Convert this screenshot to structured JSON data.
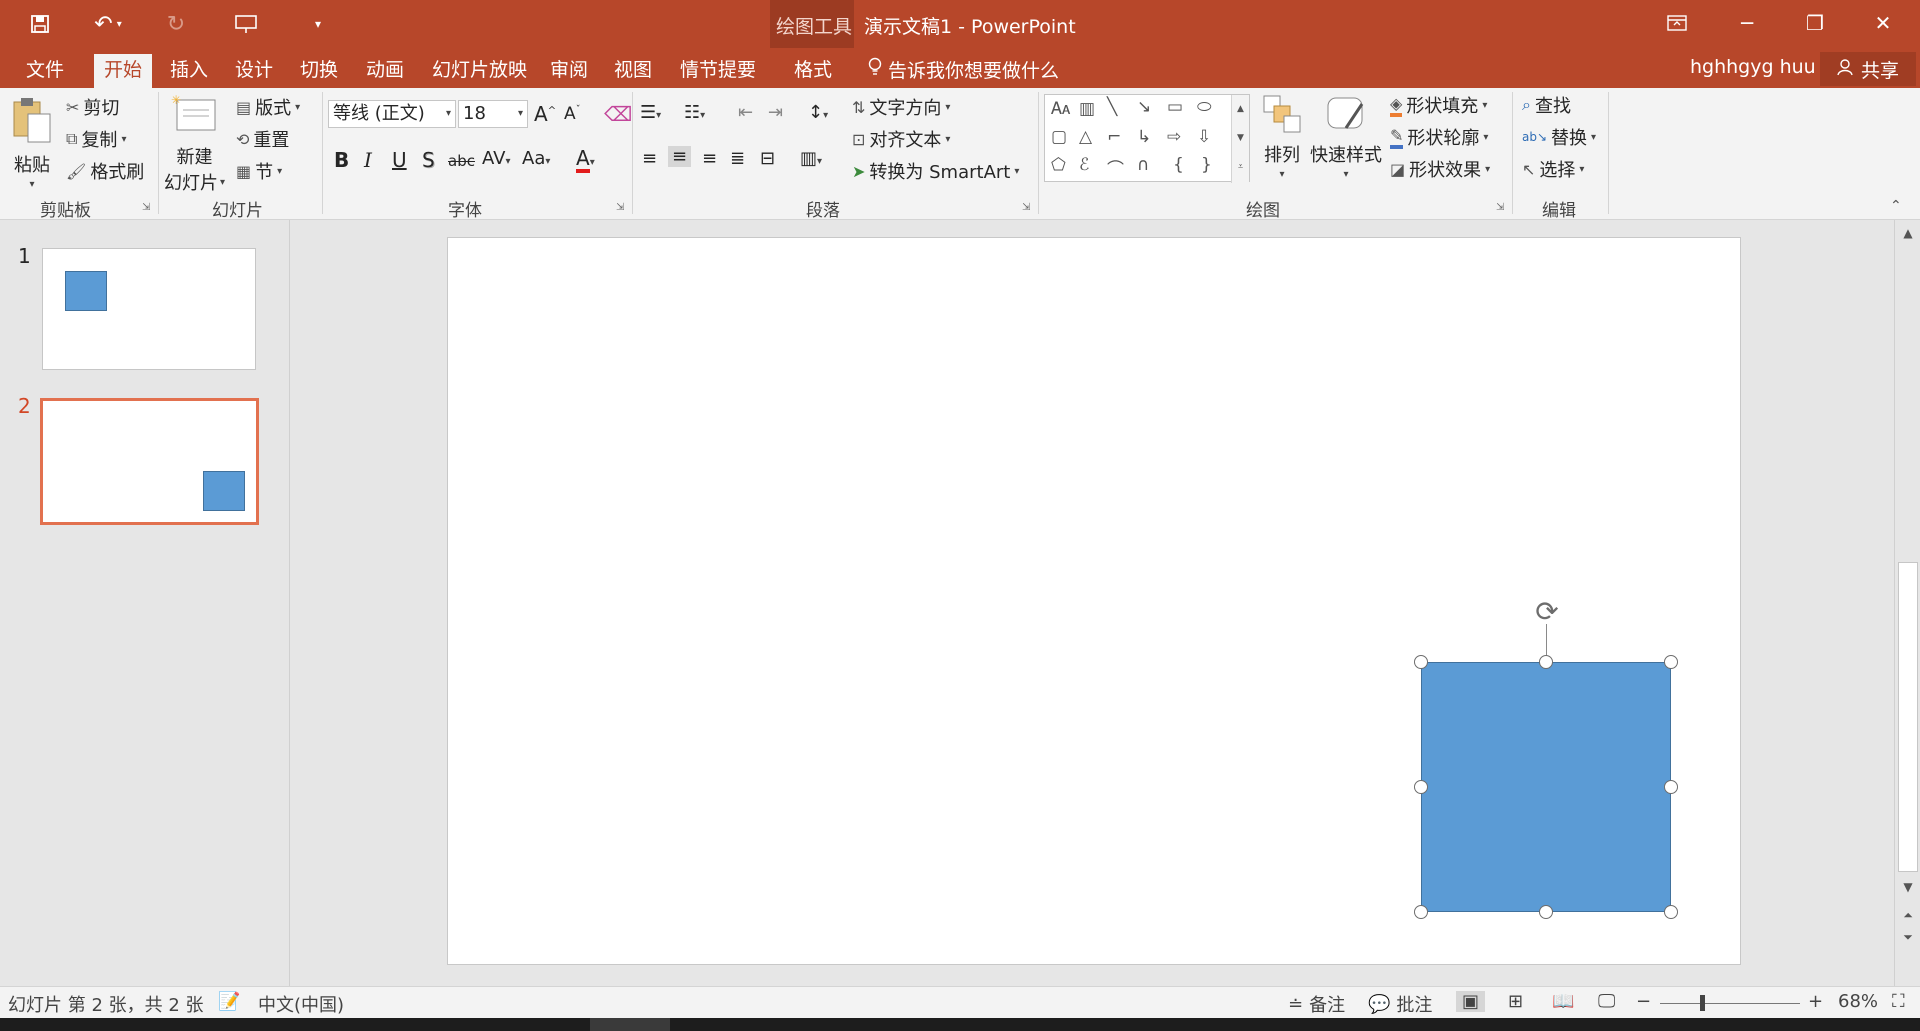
{
  "window": {
    "context_tab_label": "绘图工具",
    "title": "演示文稿1 - PowerPoint"
  },
  "quick_access": {
    "save_icon": "save-icon",
    "undo_icon": "undo-icon",
    "redo_icon": "redo-icon",
    "present_icon": "start-from-beginning-icon",
    "customize_icon": "customize-qat-icon"
  },
  "tabs": [
    {
      "label": "文件"
    },
    {
      "label": "开始"
    },
    {
      "label": "插入"
    },
    {
      "label": "设计"
    },
    {
      "label": "切换"
    },
    {
      "label": "动画"
    },
    {
      "label": "幻灯片放映"
    },
    {
      "label": "审阅"
    },
    {
      "label": "视图"
    },
    {
      "label": "情节提要"
    },
    {
      "label": "格式"
    }
  ],
  "tell_me": "告诉我你想要做什么",
  "user": {
    "name": "hghhgyg huu",
    "share_label": "共享"
  },
  "ribbon": {
    "clipboard": {
      "label": "剪贴板",
      "paste": "粘贴",
      "cut": "剪切",
      "copy": "复制",
      "format_painter": "格式刷"
    },
    "slides": {
      "label": "幻灯片",
      "new_slide_line1": "新建",
      "new_slide_line2": "幻灯片",
      "layout": "版式",
      "reset": "重置",
      "section": "节"
    },
    "font": {
      "label": "字体",
      "font_name": "等线 (正文)",
      "font_size": "18",
      "bold": "B",
      "italic": "I",
      "underline": "U",
      "shadow": "S",
      "strike": "abc",
      "spacing": "AV",
      "case": "Aa"
    },
    "paragraph": {
      "label": "段落",
      "text_direction": "文字方向",
      "align_text": "对齐文本",
      "smartart": "转换为 SmartArt"
    },
    "drawing": {
      "label": "绘图",
      "arrange": "排列",
      "quick_styles": "快速样式",
      "shape_fill": "形状填充",
      "shape_outline": "形状轮廓",
      "shape_effects": "形状效果"
    },
    "editing": {
      "label": "编辑",
      "find": "查找",
      "replace": "替换",
      "select": "选择"
    }
  },
  "thumbnails": [
    {
      "number": "1"
    },
    {
      "number": "2"
    }
  ],
  "shape_fill_color": "#5b9bd5",
  "accent_color": "#b7472a",
  "status": {
    "slide_info": "幻灯片 第 2 张，共 2 张",
    "language": "中文(中国)",
    "notes": "备注",
    "comments": "批注",
    "zoom": "68%"
  }
}
